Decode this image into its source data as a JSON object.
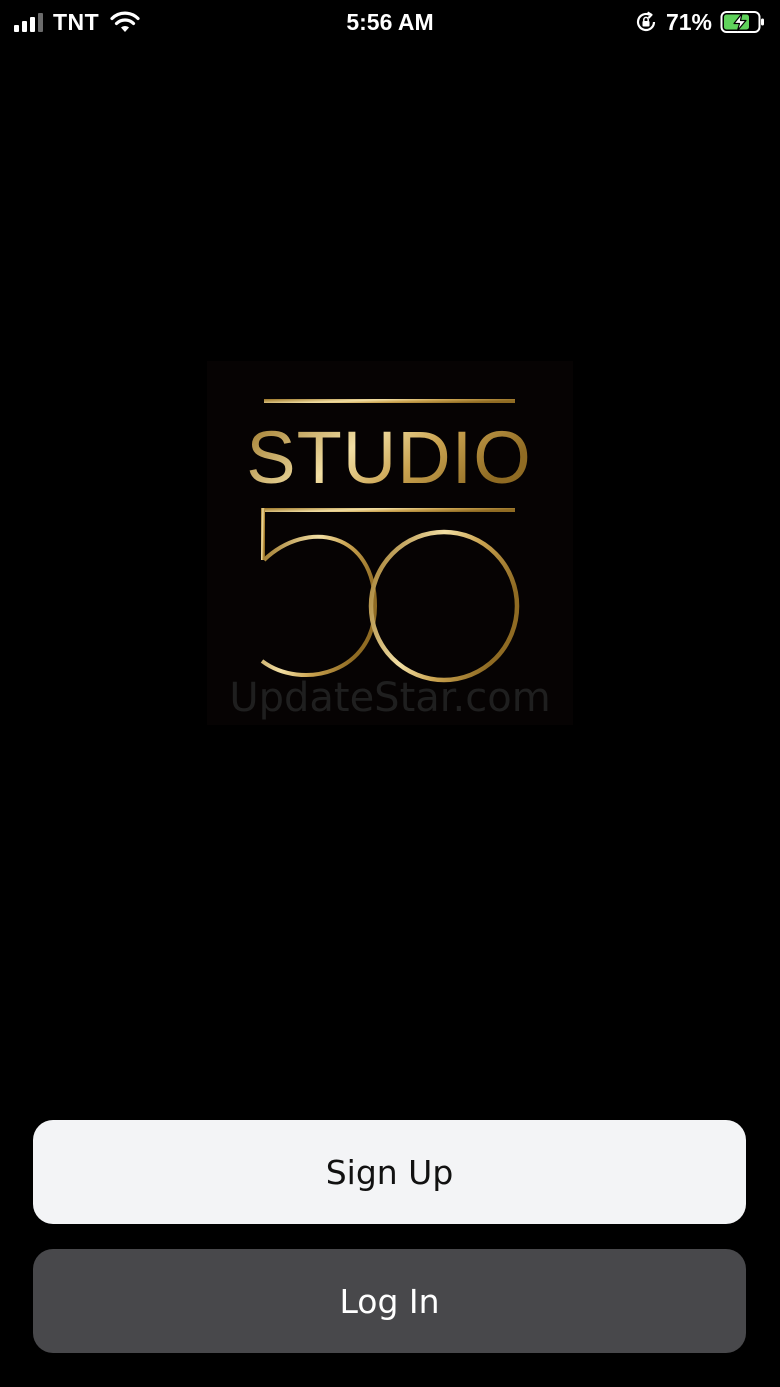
{
  "status_bar": {
    "carrier": "TNT",
    "time": "5:56 AM",
    "battery_percent": "71%",
    "icons": [
      "signal-icon",
      "wifi-icon",
      "orientation-lock-icon",
      "battery-charging-icon"
    ]
  },
  "logo": {
    "text": "STUDIO",
    "number": "50",
    "watermark": "UpdateStar.com",
    "colors": {
      "gold_dark": "#9a7426",
      "gold_light": "#f2dfa4",
      "background": "#060303"
    }
  },
  "buttons": {
    "signup_label": "Sign Up",
    "login_label": "Log In"
  },
  "colors": {
    "background": "#000000",
    "signup_bg": "#f3f4f6",
    "login_bg": "#48484b",
    "battery_fill": "#5fd35b"
  }
}
